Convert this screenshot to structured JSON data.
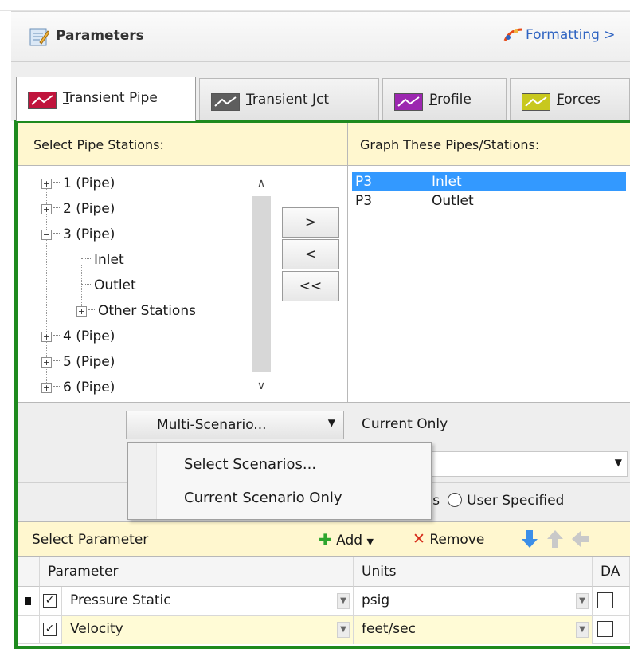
{
  "panel": {
    "title": "Parameters",
    "formatting_label": "Formatting >"
  },
  "tabs": [
    {
      "label": "Transient Pipe",
      "underline": "T",
      "rest": "ransient Pipe",
      "color": "#c0143c"
    },
    {
      "label": "Transient Jct",
      "underline": "T",
      "rest": "ransient Jct",
      "color": "#5e5e5e"
    },
    {
      "label": "Profile",
      "underline": "P",
      "rest": "rofile",
      "color": "#9c27b0"
    },
    {
      "label": "Forces",
      "underline": "F",
      "rest": "orces",
      "color": "#c8c81e"
    }
  ],
  "stations": {
    "left_header": "Select Pipe Stations:",
    "right_header": "Graph These Pipes/Stations:",
    "tree": [
      "1 (Pipe)",
      "2 (Pipe)",
      "3 (Pipe)",
      "Inlet",
      "Outlet",
      "Other Stations",
      "4 (Pipe)",
      "5 (Pipe)",
      "6 (Pipe)"
    ],
    "buttons": {
      "add": ">",
      "remove": "<",
      "remove_all": "<<"
    },
    "graph_items": [
      {
        "pipe": "P3",
        "station": "Inlet",
        "selected": true
      },
      {
        "pipe": "P3",
        "station": "Outlet",
        "selected": false
      }
    ]
  },
  "scenario": {
    "dropdown_label": "Multi-Scenario...",
    "current_value": "Current Only",
    "menu": [
      "Select Scenarios...",
      "Current Scenario Only"
    ],
    "row3_partial": "nes",
    "user_specified": "User Specified"
  },
  "parameters": {
    "header": "Select Parameter",
    "add_label": "Add",
    "remove_label": "Remove",
    "columns": [
      "Parameter",
      "Units",
      "DA"
    ],
    "rows": [
      {
        "parameter": "Pressure Static",
        "units": "psig",
        "checked": true,
        "da": false,
        "current": true
      },
      {
        "parameter": "Velocity",
        "units": "feet/sec",
        "checked": true,
        "da": false,
        "current": false
      }
    ]
  },
  "colors": {
    "frame": "#1e8a1e",
    "header_bg": "#fff7cf",
    "selection": "#3399ff"
  }
}
